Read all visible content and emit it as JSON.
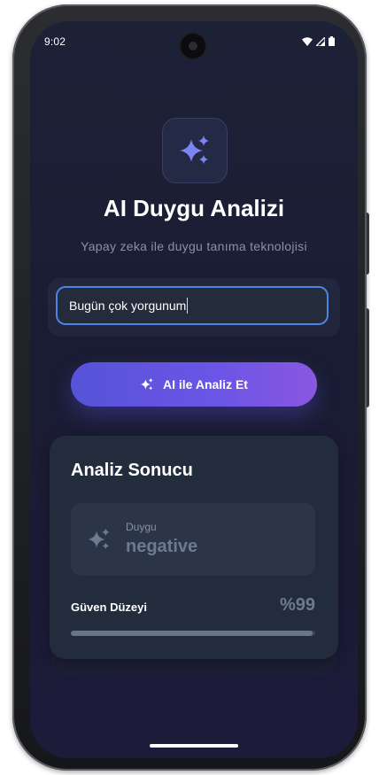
{
  "status_bar": {
    "time": "9:02",
    "icons": [
      "wifi-icon",
      "signal-icon",
      "battery-icon"
    ]
  },
  "header": {
    "logo_icon": "sparkles-icon",
    "title": "AI Duygu Analizi",
    "subtitle": "Yapay zeka ile duygu tanıma teknolojisi"
  },
  "input": {
    "value": "Bugün çok yorgunum"
  },
  "analyze_button": {
    "icon": "sparkles-icon",
    "label": "AI ile Analiz Et"
  },
  "result": {
    "title": "Analiz Sonucu",
    "emotion_icon": "sparkles-icon",
    "emotion_label": "Duygu",
    "emotion_value": "negative",
    "confidence_label": "Güven Düzeyi",
    "confidence_value": "%99",
    "confidence_fraction": 0.99
  },
  "colors": {
    "accent": "#4b86e6",
    "button_start": "#5654d8",
    "button_end": "#8a57e0",
    "sparkle": "#7b86f5"
  }
}
